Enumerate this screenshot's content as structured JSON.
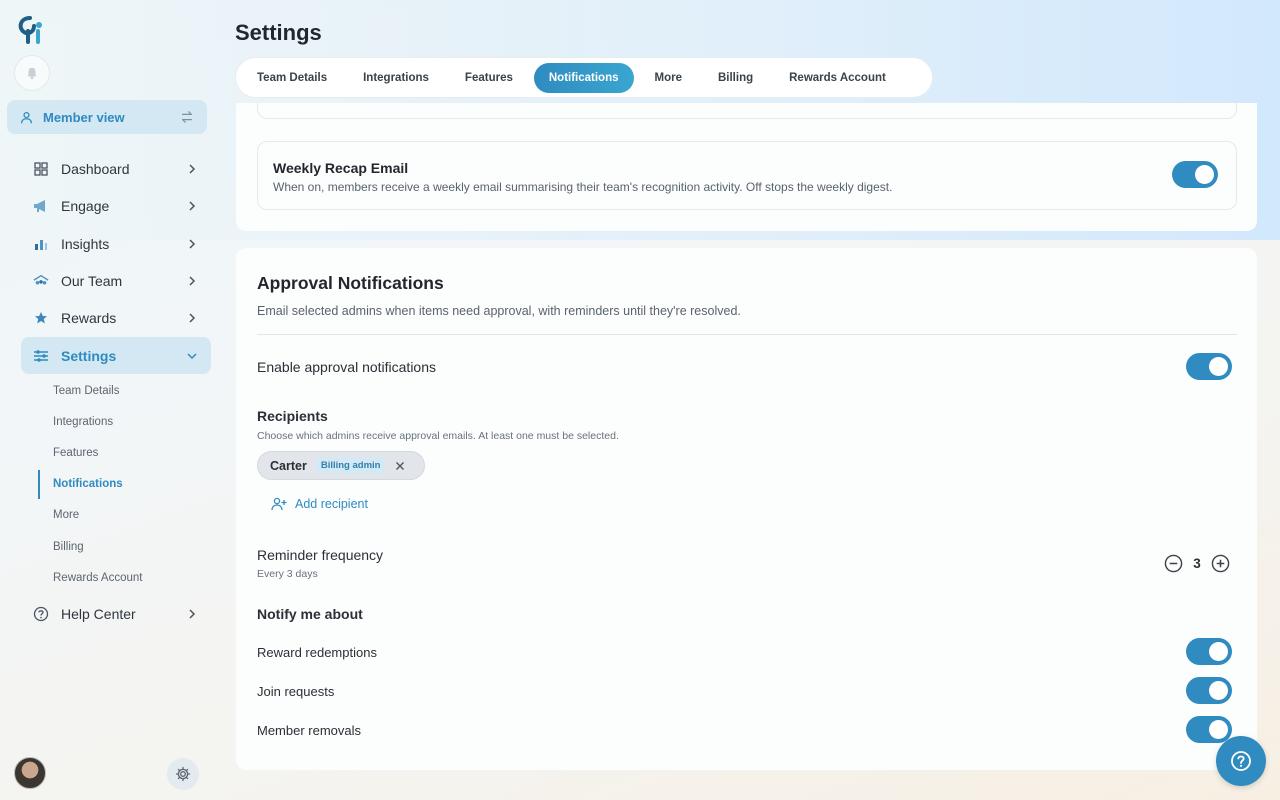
{
  "sidebar": {
    "member_view": "Member view",
    "nav": [
      {
        "label": "Dashboard",
        "icon": "grid-icon"
      },
      {
        "label": "Engage",
        "icon": "megaphone-icon"
      },
      {
        "label": "Insights",
        "icon": "bar-chart-icon"
      },
      {
        "label": "Our Team",
        "icon": "team-icon"
      },
      {
        "label": "Rewards",
        "icon": "star-icon"
      },
      {
        "label": "Settings",
        "icon": "sliders-icon"
      },
      {
        "label": "Help Center",
        "icon": "help-circle-icon"
      }
    ],
    "settings_sub": [
      "Team Details",
      "Integrations",
      "Features",
      "Notifications",
      "More",
      "Billing",
      "Rewards Account"
    ]
  },
  "header": {
    "title": "Settings",
    "tabs": [
      "Team Details",
      "Integrations",
      "Features",
      "Notifications",
      "More",
      "Billing",
      "Rewards Account"
    ],
    "active_tab": "Notifications"
  },
  "weekly_recap": {
    "title": "Weekly Recap Email",
    "description": "When on, members receive a weekly email summarising their team's recognition activity. Off stops the weekly digest.",
    "enabled": true
  },
  "approval": {
    "title": "Approval Notifications",
    "description": "Email selected admins when items need approval, with reminders until they're resolved.",
    "enable_label": "Enable approval notifications",
    "enabled": true,
    "recipients_title": "Recipients",
    "recipients_desc": "Choose which admins receive approval emails. At least one must be selected.",
    "recipients": [
      {
        "name": "Carter",
        "role": "Billing admin"
      }
    ],
    "add_recipient": "Add recipient",
    "reminder_label": "Reminder frequency",
    "reminder_desc": "Every 3 days",
    "reminder_value": "3",
    "notify_title": "Notify me about",
    "notify_items": [
      {
        "label": "Reward redemptions",
        "enabled": true
      },
      {
        "label": "Join requests",
        "enabled": true
      },
      {
        "label": "Member removals",
        "enabled": true
      }
    ]
  },
  "colors": {
    "accent": "#2f8bc0",
    "active_bg": "#d3e8f2"
  }
}
